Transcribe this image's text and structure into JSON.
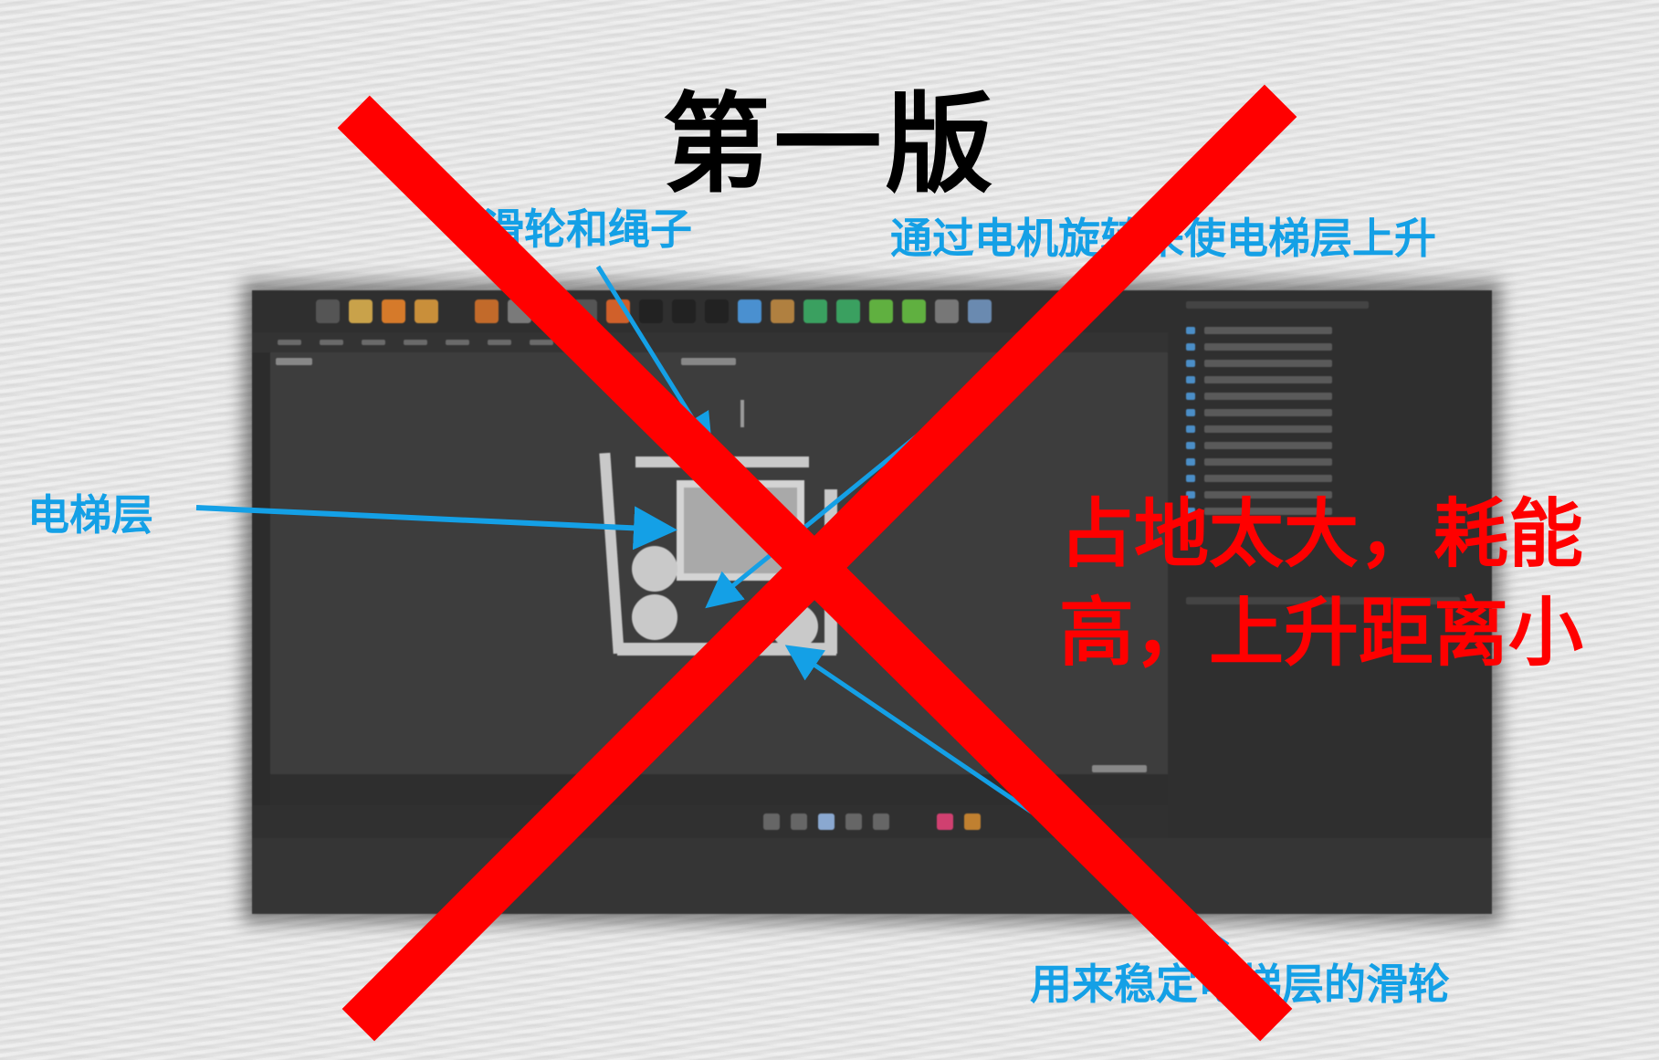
{
  "slide": {
    "title": "第一版",
    "labels": {
      "pulley_rope": "滑轮和绳子",
      "motor_rotation": "通过电机旋转来使电梯层上升",
      "elevator_floor": "电梯层",
      "stabilizer_pulley": "用来稳定电梯层的滑轮"
    },
    "verdict": {
      "line1": "占地太大，耗能",
      "line2": "高，上升距离小"
    },
    "colors": {
      "annotation": "#14a0e6",
      "cross": "#ff0000",
      "verdict": "#ff0000",
      "title": "#000000"
    }
  },
  "screenshot": {
    "app": "Cinema 4D viewport",
    "icon_names": [
      "cube-icon",
      "pen-icon",
      "gear-icon",
      "light-icon",
      "camera-icon"
    ]
  }
}
